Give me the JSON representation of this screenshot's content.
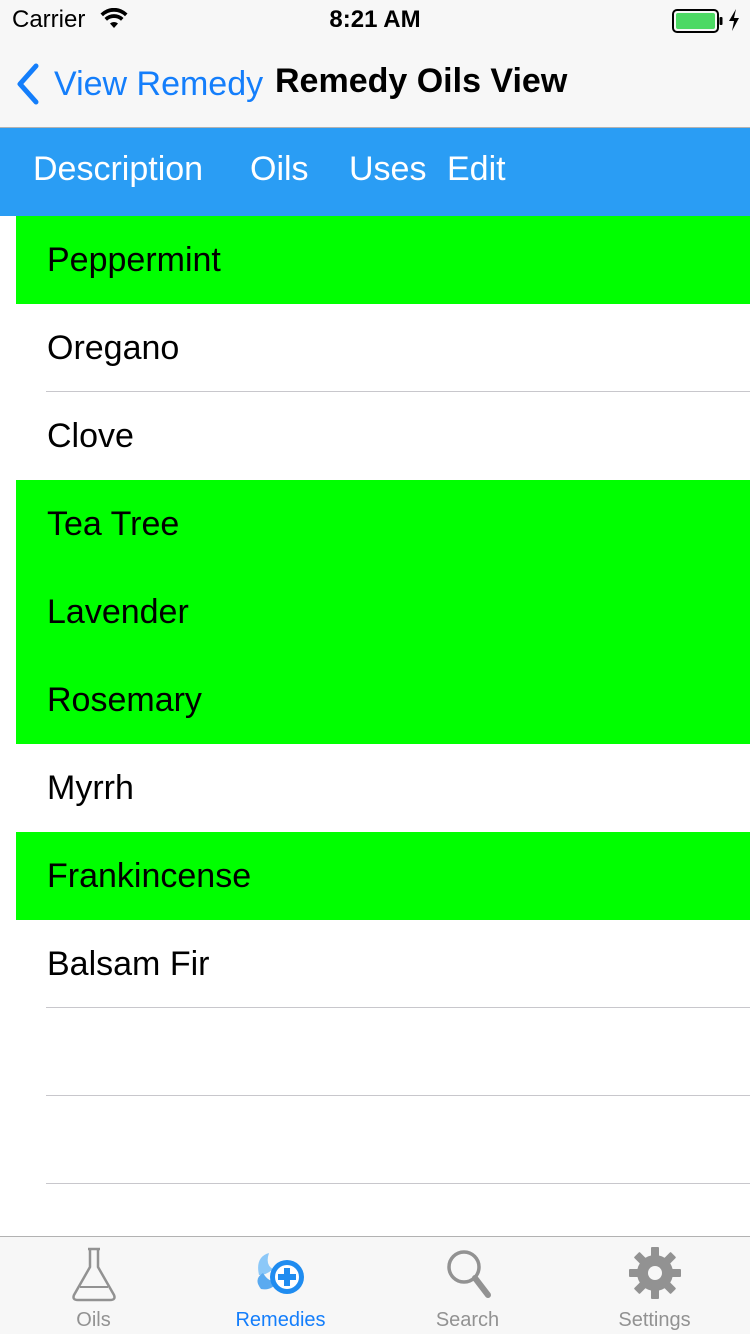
{
  "status_bar": {
    "carrier": "Carrier",
    "time": "8:21 AM"
  },
  "nav": {
    "back_label": "View Remedy",
    "title": "Remedy Oils View"
  },
  "segments": [
    {
      "label": "Description"
    },
    {
      "label": "Oils"
    },
    {
      "label": "Uses"
    },
    {
      "label": "Edit"
    }
  ],
  "colors": {
    "accent": "#147efb",
    "segment_bar": "#2a9df4",
    "highlight": "#00ff00",
    "tab_inactive": "#929292"
  },
  "oils": [
    {
      "name": "Peppermint",
      "highlighted": true
    },
    {
      "name": "Oregano",
      "highlighted": false
    },
    {
      "name": "Clove",
      "highlighted": false
    },
    {
      "name": "Tea Tree",
      "highlighted": true
    },
    {
      "name": "Lavender",
      "highlighted": true
    },
    {
      "name": "Rosemary",
      "highlighted": true
    },
    {
      "name": "Myrrh",
      "highlighted": false
    },
    {
      "name": "Frankincense",
      "highlighted": true
    },
    {
      "name": "Balsam Fir",
      "highlighted": false
    },
    {
      "name": "",
      "highlighted": false
    },
    {
      "name": "",
      "highlighted": false
    },
    {
      "name": "",
      "highlighted": false
    }
  ],
  "tabs": [
    {
      "label": "Oils",
      "icon": "flask-icon",
      "selected": false
    },
    {
      "label": "Remedies",
      "icon": "remedies-icon",
      "selected": true
    },
    {
      "label": "Search",
      "icon": "search-icon",
      "selected": false
    },
    {
      "label": "Settings",
      "icon": "gear-icon",
      "selected": false
    }
  ]
}
